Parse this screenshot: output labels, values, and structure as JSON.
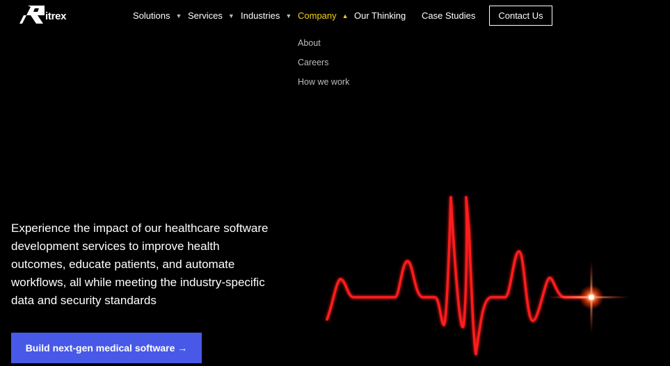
{
  "brand": {
    "name": "itrex"
  },
  "nav": {
    "items": [
      {
        "label": "Solutions",
        "has_caret": true
      },
      {
        "label": "Services",
        "has_caret": true
      },
      {
        "label": "Industries",
        "has_caret": true
      },
      {
        "label": "Company",
        "has_caret": true,
        "active": true
      },
      {
        "label": "Our Thinking",
        "has_caret": false
      },
      {
        "label": "Case Studies",
        "has_caret": false
      }
    ],
    "contact_label": "Contact Us",
    "caret_down": "▼",
    "caret_up": "▲"
  },
  "dropdown": {
    "items": [
      "About",
      "Careers",
      "How we work"
    ]
  },
  "hero": {
    "text": "Experience the impact of our healthcare software development services to improve health outcomes, educate patients, and automate workflows, all while meeting the industry-specific data and security standards",
    "cta_label": "Build next-gen medical software →"
  },
  "colors": {
    "background": "#000000",
    "active_nav": "#f5d313",
    "cta": "#4859e8",
    "ekg_line": "#ff1a1a"
  }
}
